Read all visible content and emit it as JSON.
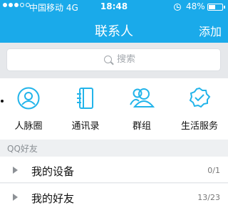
{
  "status_bar": {
    "carrier": "中国移动 4G",
    "time": "18:48",
    "battery": "48%",
    "battery_level": 0.48,
    "signal_filled": 3,
    "signal_total": 5
  },
  "nav": {
    "title": "联系人",
    "add_label": "添加"
  },
  "search": {
    "placeholder": "搜索"
  },
  "quick_actions": [
    {
      "label": "人脉圈",
      "icon": "person-circle-icon"
    },
    {
      "label": "通讯录",
      "icon": "address-book-icon"
    },
    {
      "label": "群组",
      "icon": "group-icon"
    },
    {
      "label": "生活服务",
      "icon": "service-badge-icon"
    }
  ],
  "section": {
    "title": "QQ好友"
  },
  "groups": [
    {
      "name": "我的设备",
      "count": "0/1"
    },
    {
      "name": "我的好友",
      "count": "13/23"
    }
  ],
  "colors": {
    "accent": "#1aaaea",
    "icon": "#22b4ea"
  }
}
